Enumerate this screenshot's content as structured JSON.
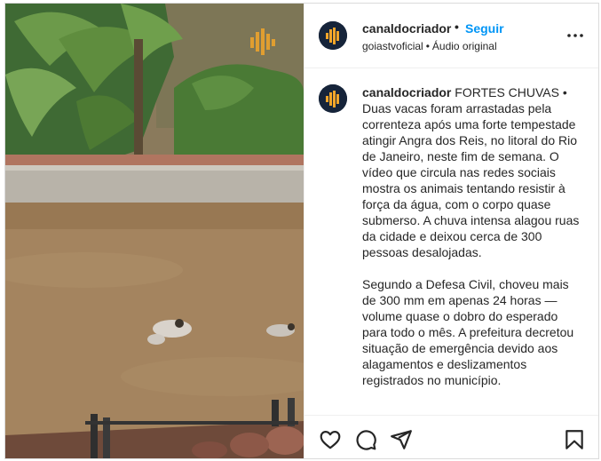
{
  "post": {
    "media": {
      "description_icon": "audio-wave-icon"
    },
    "header": {
      "username": "canaldocriador",
      "separator": "•",
      "follow_label": "Seguir",
      "account_line": "goiastvoficial",
      "audio_separator": "•",
      "audio_label": "Áudio original",
      "more_icon": "more-options-icon"
    },
    "caption": {
      "username": "canaldocriador",
      "paragraph1": "FORTES CHUVAS • Duas vacas foram arrastadas pela correnteza após uma forte tempestade atingir Angra dos Reis, no litoral do Rio de Janeiro, neste fim de semana. O vídeo que circula nas redes sociais mostra os animais tentando resistir à força da água, com o corpo quase submerso. A chuva intensa alagou ruas da cidade e deixou cerca de 300 pessoas desalojadas.",
      "paragraph2": "Segundo a Defesa Civil, choveu mais de 300 mm em apenas 24 horas — volume quase o dobro do esperado para todo o mês. A prefeitura decretou situação de emergência devido aos alagamentos e deslizamentos registrados no município."
    },
    "actions": {
      "like_icon": "heart-icon",
      "comment_icon": "comment-icon",
      "share_icon": "share-icon",
      "save_icon": "bookmark-icon"
    }
  },
  "colors": {
    "link_blue": "#0095f6",
    "text": "#262626",
    "avatar_bg": "#16243a",
    "avatar_logo": "#f2a62a"
  }
}
